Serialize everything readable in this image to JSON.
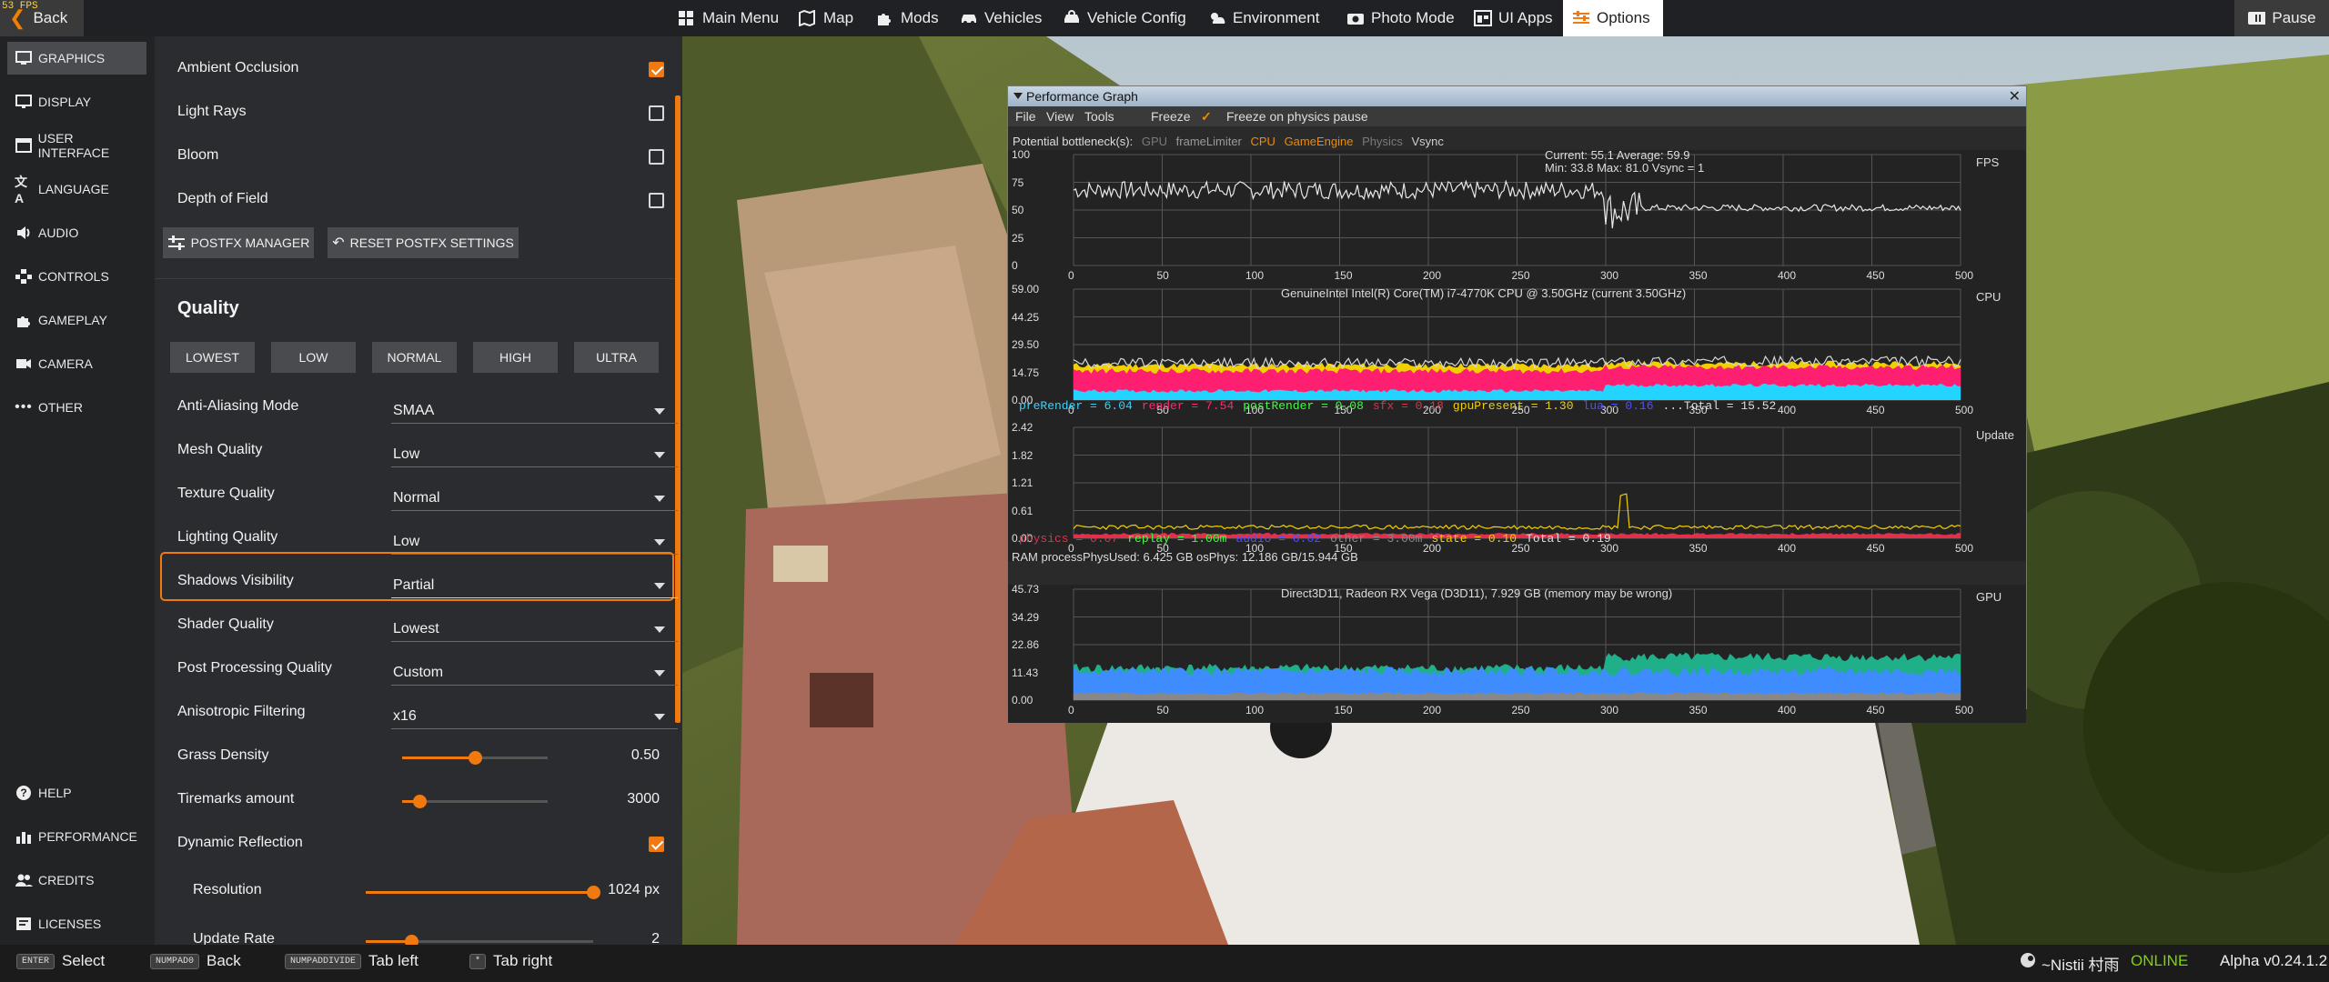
{
  "topbar": {
    "fps": "53 FPS",
    "back": "Back",
    "items": [
      {
        "label": "Main Menu",
        "icon": "grid-icon"
      },
      {
        "label": "Map",
        "icon": "map-icon"
      },
      {
        "label": "Mods",
        "icon": "puzzle-icon"
      },
      {
        "label": "Vehicles",
        "icon": "car-icon"
      },
      {
        "label": "Vehicle Config",
        "icon": "vehicle-config-icon"
      },
      {
        "label": "Environment",
        "icon": "weather-icon"
      },
      {
        "label": "Photo Mode",
        "icon": "camera-icon"
      },
      {
        "label": "UI Apps",
        "icon": "ui-apps-icon"
      },
      {
        "label": "Options",
        "icon": "options-icon"
      }
    ],
    "pause": "Pause"
  },
  "sidebar": {
    "items": [
      {
        "label": "GRAPHICS",
        "icon": "monitor-icon",
        "active": true
      },
      {
        "label": "DISPLAY",
        "icon": "display-icon"
      },
      {
        "label": "USER INTERFACE",
        "icon": "ui-icon"
      },
      {
        "label": "LANGUAGE",
        "icon": "language-icon"
      },
      {
        "label": "AUDIO",
        "icon": "audio-icon"
      },
      {
        "label": "CONTROLS",
        "icon": "controls-icon"
      },
      {
        "label": "GAMEPLAY",
        "icon": "gameplay-icon"
      },
      {
        "label": "CAMERA",
        "icon": "camera-icon"
      },
      {
        "label": "OTHER",
        "icon": "more-icon"
      }
    ],
    "bottom": [
      {
        "label": "HELP",
        "icon": "help-icon"
      },
      {
        "label": "PERFORMANCE",
        "icon": "chart-icon"
      },
      {
        "label": "CREDITS",
        "icon": "users-icon"
      },
      {
        "label": "LICENSES",
        "icon": "license-icon"
      }
    ]
  },
  "settings": {
    "toggles_top": [
      {
        "label": "Ambient Occlusion",
        "checked": true
      },
      {
        "label": "Light Rays",
        "checked": false
      },
      {
        "label": "Bloom",
        "checked": false
      },
      {
        "label": "Depth of Field",
        "checked": false
      }
    ],
    "postfx_manager": "POSTFX MANAGER",
    "reset_postfx": "RESET POSTFX SETTINGS",
    "quality_heading": "Quality",
    "presets": [
      "LOWEST",
      "LOW",
      "NORMAL",
      "HIGH",
      "ULTRA"
    ],
    "selects": [
      {
        "label": "Anti-Aliasing Mode",
        "value": "SMAA"
      },
      {
        "label": "Mesh Quality",
        "value": "Low"
      },
      {
        "label": "Texture Quality",
        "value": "Normal"
      },
      {
        "label": "Lighting Quality",
        "value": "Low"
      },
      {
        "label": "Shadows Visibility",
        "value": "Partial"
      },
      {
        "label": "Shader Quality",
        "value": "Lowest"
      },
      {
        "label": "Post Processing Quality",
        "value": "Custom"
      },
      {
        "label": "Anisotropic Filtering",
        "value": "x16"
      }
    ],
    "grass": {
      "label": "Grass Density",
      "value": "0.50",
      "fraction": 0.5
    },
    "tiremarks": {
      "label": "Tiremarks amount",
      "value": "3000",
      "fraction": 0.12
    },
    "dyn_reflection": {
      "label": "Dynamic Reflection",
      "checked": true
    },
    "resolution": {
      "label": "Resolution",
      "value": "1024 px",
      "fraction": 1.0
    },
    "update_rate": {
      "label": "Update Rate",
      "value": "2",
      "fraction": 0.2
    }
  },
  "bottombar": {
    "hints": [
      {
        "key": "ENTER",
        "label": "Select"
      },
      {
        "key": "NUMPAD0",
        "label": "Back"
      },
      {
        "key": "NUMPADDIVIDE",
        "label": "Tab left"
      },
      {
        "key": "*",
        "label": "Tab right"
      }
    ],
    "user": "~Nistii 村雨",
    "status": "ONLINE",
    "version": "Alpha v0.24.1.2"
  },
  "perf": {
    "title": "Performance Graph",
    "menu": [
      "File",
      "View",
      "Tools"
    ],
    "freeze": "Freeze",
    "freeze_physics": "Freeze on physics pause",
    "bottleneck_label": "Potential bottleneck(s):",
    "bottlenecks": [
      {
        "name": "GPU",
        "color": "#7a7a7a"
      },
      {
        "name": "frameLimiter",
        "color": "#9a9a9a"
      },
      {
        "name": "CPU",
        "color": "#f08a00"
      },
      {
        "name": "GameEngine",
        "color": "#f08a00"
      },
      {
        "name": "Physics",
        "color": "#7a7a7a"
      },
      {
        "name": "Vsync",
        "color": "#cfcfcf"
      }
    ],
    "fps_label": "FPS",
    "fps_current": "Current: 55.1    Average: 59.9",
    "fps_minmax": "Min: 33.8   Max: 81.0 Vsync = 1",
    "fps_yticks": [
      "100",
      "75",
      "50",
      "25",
      "0"
    ],
    "xticks": [
      "0",
      "50",
      "100",
      "150",
      "200",
      "250",
      "300",
      "350",
      "400",
      "450",
      "500"
    ],
    "cpu_label": "CPU",
    "cpu_title": "GenuineIntel Intel(R) Core(TM) i7-4770K CPU @ 3.50GHz (current 3.50GHz)",
    "cpu_yticks": [
      "59.00",
      "44.25",
      "29.50",
      "14.75",
      "0.00"
    ],
    "cpu_legend": [
      {
        "text": "preRender =    6.04",
        "color": "#33d4ff"
      },
      {
        "text": "render =    7.54",
        "color": "#ff2a6a"
      },
      {
        "text": "postRender =    0.08",
        "color": "#3cff3c"
      },
      {
        "text": "sfx =    0.18",
        "color": "#e0304a"
      },
      {
        "text": "gpuPresent =    1.30",
        "color": "#f0d000"
      },
      {
        "text": "lua =    0.16",
        "color": "#5050ff"
      },
      {
        "text": "...Total = 15.52",
        "color": "#dddddd"
      }
    ],
    "update_label": "Update",
    "update_yticks": [
      "2.42",
      "1.82",
      "1.21",
      "0.61",
      "0.00"
    ],
    "update_legend": [
      {
        "text": "physics =    0.07",
        "color": "#e0304a"
      },
      {
        "text": "replay =    1.00m",
        "color": "#3cff3c"
      },
      {
        "text": "audio =    0.02",
        "color": "#5050ff"
      },
      {
        "text": "other =    3.00m",
        "color": "#888888"
      },
      {
        "text": "state =    0.10",
        "color": "#f0d000"
      },
      {
        "text": "Total = 0.19",
        "color": "#dddddd"
      }
    ],
    "ram_text": "RAM  processPhysUsed: 6.425 GB  osPhys: 12.186 GB/15.944 GB",
    "gpu_label": "GPU",
    "gpu_title": "Direct3D11, Radeon RX Vega (D3D11), 7.929 GB (memory may be wrong)",
    "gpu_yticks": [
      "45.73",
      "34.29",
      "22.86",
      "11.43",
      "0.00"
    ]
  },
  "colors": {
    "accent": "#f07a10",
    "panel": "#2b2c2f",
    "online": "#7fd400"
  },
  "chart_data": [
    {
      "type": "line",
      "title": "FPS",
      "x_range": [
        0,
        500
      ],
      "ylim": [
        0,
        100
      ],
      "series": [
        {
          "name": "FPS",
          "approx_level_before_250": 70,
          "approx_level_after_250": 52
        }
      ]
    },
    {
      "type": "area",
      "title": "CPU",
      "x_range": [
        0,
        500
      ],
      "ylim": [
        0,
        59
      ],
      "series": [
        {
          "name": "preRender",
          "value": 6.04
        },
        {
          "name": "render",
          "value": 7.54
        },
        {
          "name": "postRender",
          "value": 0.08
        },
        {
          "name": "sfx",
          "value": 0.18
        },
        {
          "name": "gpuPresent",
          "value": 1.3
        },
        {
          "name": "lua",
          "value": 0.16
        }
      ]
    },
    {
      "type": "area",
      "title": "Update",
      "x_range": [
        0,
        500
      ],
      "ylim": [
        0,
        2.42
      ],
      "series": [
        {
          "name": "state",
          "value": 0.1
        },
        {
          "name": "physics",
          "value": 0.07
        }
      ]
    },
    {
      "type": "area",
      "title": "GPU",
      "x_range": [
        0,
        500
      ],
      "ylim": [
        0,
        45.73
      ]
    }
  ]
}
